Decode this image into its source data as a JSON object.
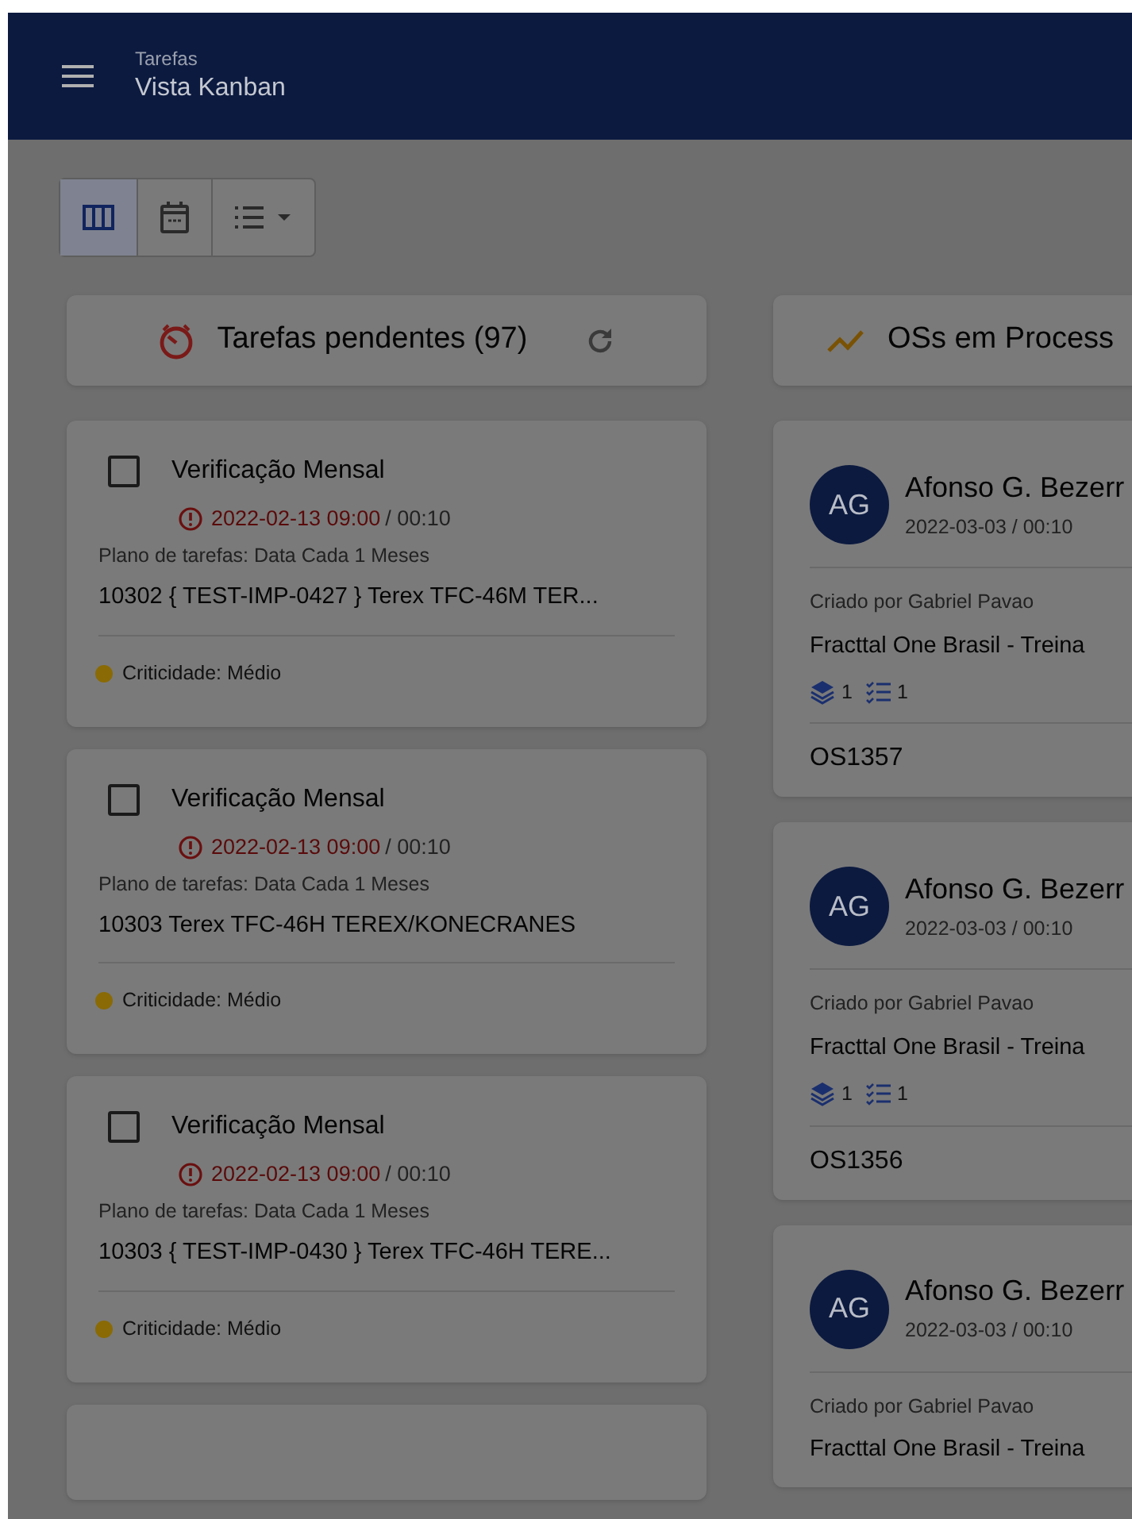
{
  "header": {
    "section": "Tarefas",
    "title": "Vista Kanban"
  },
  "view_buttons": [
    {
      "kind": "kanban",
      "selected": true
    },
    {
      "kind": "calendar",
      "selected": false
    },
    {
      "kind": "list",
      "selected": false
    }
  ],
  "pending_column": {
    "title": "Tarefas pendentes (97)",
    "refresh": true,
    "cards": [
      {
        "checked": false,
        "title": "Verificação Mensal",
        "due": "2022-02-13 09:00",
        "overdue": true,
        "duration": "/ 00:10",
        "plan": "Plano de tarefas: Data Cada 1 Meses",
        "asset": "10302 { TEST-IMP-0427 } Terex TFC-46M TER...",
        "criticality": "Criticidade: Médio",
        "color": "#8a6a04"
      },
      {
        "checked": false,
        "title": "Verificação Mensal",
        "due": "2022-02-13 09:00",
        "overdue": true,
        "duration": "/ 00:10",
        "plan": "Plano de tarefas: Data Cada 1 Meses",
        "asset": "10303 Terex TFC-46H TEREX/KONECRANES",
        "criticality": "Criticidade: Médio",
        "color": "#8a6a04"
      },
      {
        "checked": false,
        "title": "Verificação Mensal",
        "due": "2022-02-13 09:00",
        "overdue": true,
        "duration": "/ 00:10",
        "plan": "Plano de tarefas: Data Cada 1 Meses",
        "asset": "10303 { TEST-IMP-0430 } Terex TFC-46H TERE...",
        "criticality": "Criticidade: Médio",
        "color": "#8a6a04"
      }
    ],
    "more_below": true
  },
  "process_column": {
    "title": "OSs em Process",
    "cards": [
      {
        "initials": "AG",
        "name": "Afonso G. Bezerr",
        "date": "2022-03-03 / 00:10",
        "created_by": "Criado por Gabriel Pavao",
        "company": "Fracttal One Brasil - Treina",
        "assets": "1",
        "tasks": "1",
        "code": "OS1357"
      },
      {
        "initials": "AG",
        "name": "Afonso G. Bezerr",
        "date": "2022-03-03 / 00:10",
        "created_by": "Criado por Gabriel Pavao",
        "company": "Fracttal One Brasil - Treina",
        "assets": "1",
        "tasks": "1",
        "code": "OS1356"
      },
      {
        "initials": "AG",
        "name": "Afonso G. Bezerr",
        "date": "2022-03-03 / 00:10",
        "created_by": "Criado por Gabriel Pavao",
        "company": "Fracttal One Brasil - Treina"
      }
    ]
  }
}
